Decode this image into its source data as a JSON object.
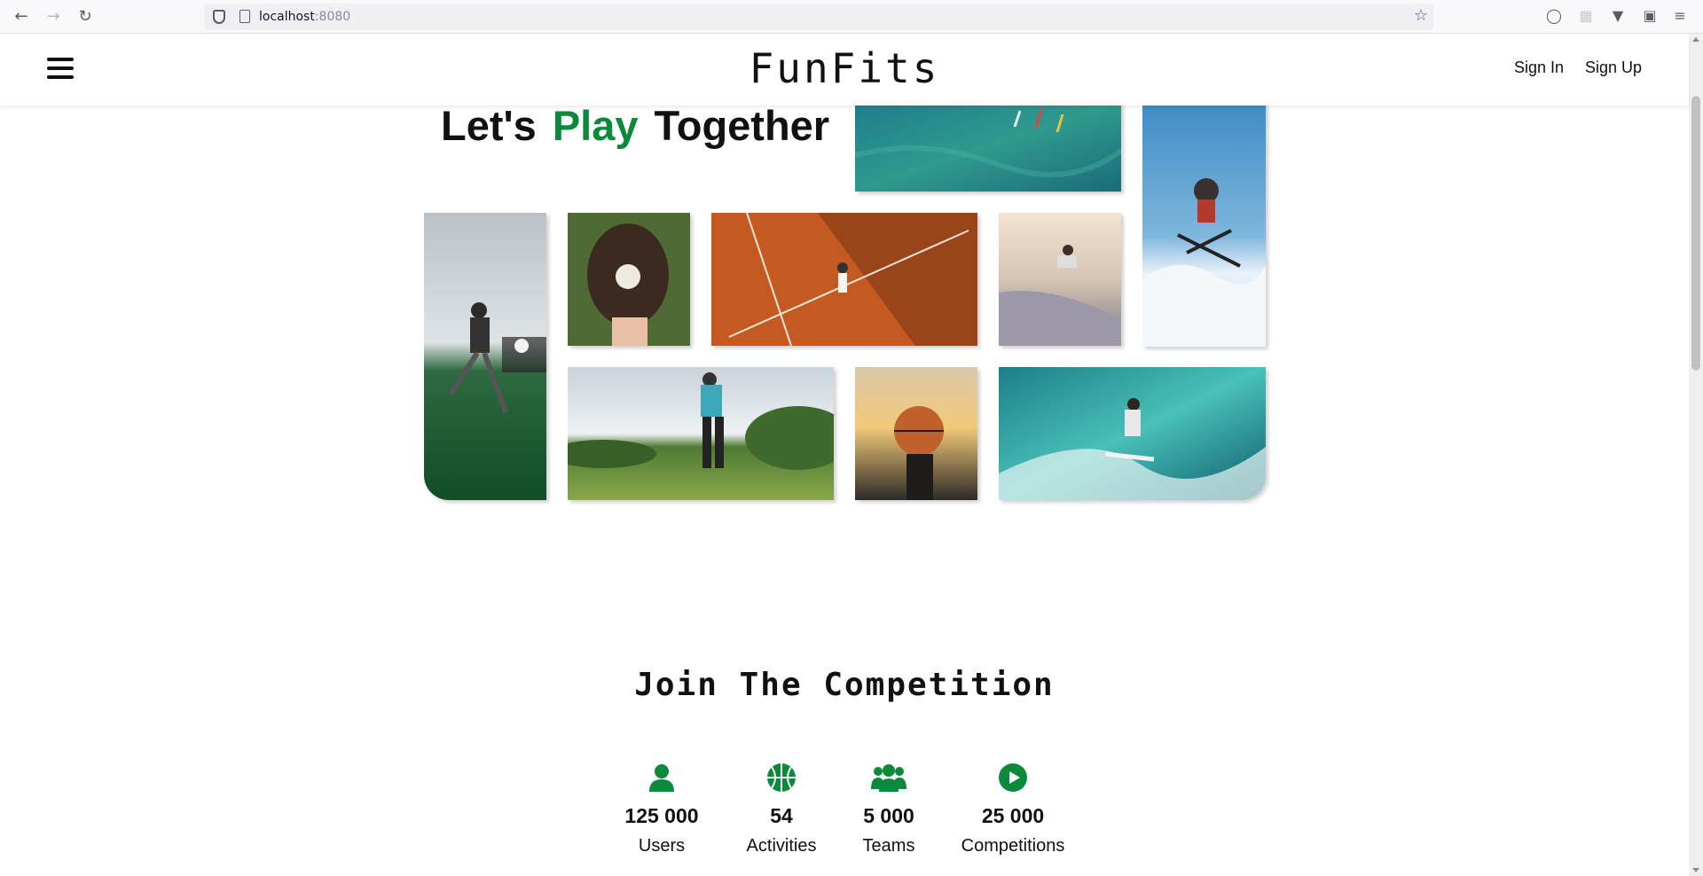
{
  "browser": {
    "url_host": "localhost",
    "url_port": ":8080"
  },
  "header": {
    "logo": "FunFits",
    "sign_in": "Sign In",
    "sign_up": "Sign Up"
  },
  "hero": {
    "word1": "Let's",
    "word2": "Play",
    "word3": "Together",
    "accent_color": "#0a8a3a"
  },
  "join": {
    "title": "Join The Competition",
    "stats": [
      {
        "icon": "user-icon",
        "value": "125 000",
        "label": "Users"
      },
      {
        "icon": "basketball-icon",
        "value": "54",
        "label": "Activities"
      },
      {
        "icon": "team-icon",
        "value": "5 000",
        "label": "Teams"
      },
      {
        "icon": "play-icon",
        "value": "25 000",
        "label": "Competitions"
      }
    ]
  },
  "colors": {
    "brand_green": "#0a8a3a"
  }
}
